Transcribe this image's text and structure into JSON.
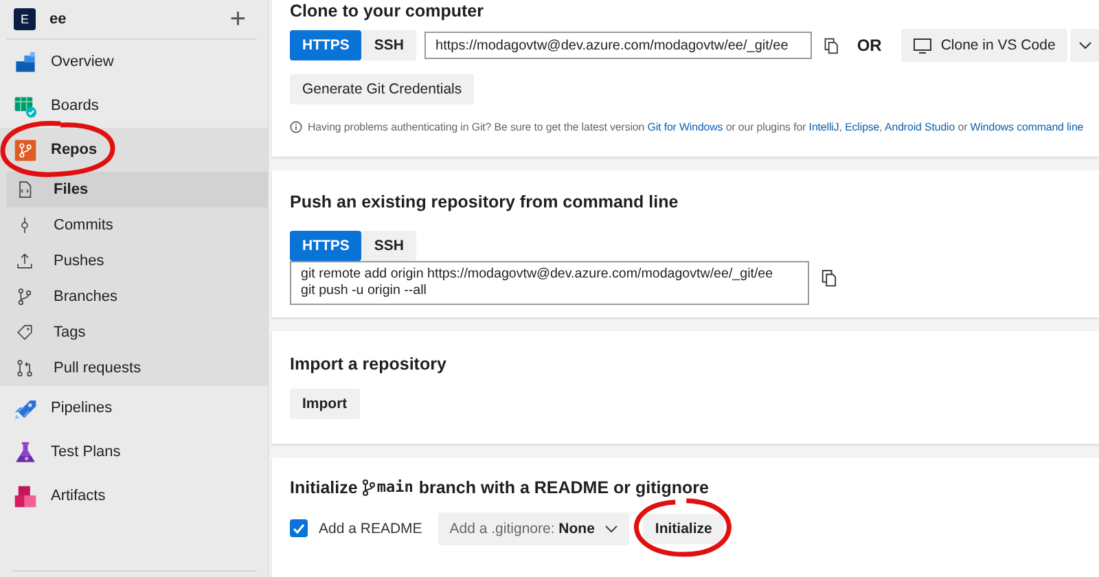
{
  "project": {
    "avatar": "E",
    "name": "ee",
    "add": "+"
  },
  "nav": [
    {
      "kind": "overview",
      "label": "Overview",
      "selected": false
    },
    {
      "kind": "boards",
      "label": "Boards",
      "selected": false
    },
    {
      "kind": "repos",
      "label": "Repos",
      "selected": false,
      "expanded": true,
      "children": [
        {
          "kind": "files",
          "label": "Files",
          "selected": true
        },
        {
          "kind": "commits",
          "label": "Commits",
          "selected": false
        },
        {
          "kind": "pushes",
          "label": "Pushes",
          "selected": false
        },
        {
          "kind": "branches",
          "label": "Branches",
          "selected": false
        },
        {
          "kind": "tags",
          "label": "Tags",
          "selected": false
        },
        {
          "kind": "pulls",
          "label": "Pull requests",
          "selected": false
        }
      ]
    },
    {
      "kind": "pipelines",
      "label": "Pipelines",
      "selected": false
    },
    {
      "kind": "testplans",
      "label": "Test Plans",
      "selected": false
    },
    {
      "kind": "artifacts",
      "label": "Artifacts",
      "selected": false
    }
  ],
  "clone": {
    "title": "Clone to your computer",
    "tabs": [
      {
        "label": "HTTPS",
        "selected": true
      },
      {
        "label": "SSH",
        "selected": false
      }
    ],
    "url": "https://modagovtw@dev.azure.com/modagovtw/ee/_git/ee",
    "or": "OR",
    "vscode_button": "Clone in VS Code",
    "credentials_button": "Generate Git Credentials",
    "help": [
      {
        "text": "Having problems authenticating in Git? Be sure to get the latest version ",
        "link": false
      },
      {
        "text": "Git for Windows",
        "link": true
      },
      {
        "text": " or our plugins for ",
        "link": false
      },
      {
        "text": "IntelliJ",
        "link": true
      },
      {
        "text": ", ",
        "link": false
      },
      {
        "text": "Eclipse",
        "link": true
      },
      {
        "text": ", ",
        "link": false
      },
      {
        "text": "Android Studio",
        "link": true
      },
      {
        "text": " or ",
        "link": false
      },
      {
        "text": "Windows command line",
        "link": true
      }
    ]
  },
  "push": {
    "title": "Push an existing repository from command line",
    "tabs": [
      {
        "label": "HTTPS",
        "selected": true
      },
      {
        "label": "SSH",
        "selected": false
      }
    ],
    "commands": [
      "git remote add origin https://modagovtw@dev.azure.com/modagovtw/ee/_git/ee",
      "git push -u origin --all"
    ]
  },
  "import": {
    "title": "Import a repository",
    "button": "Import"
  },
  "init": {
    "title_start": "Initialize",
    "branch": "main",
    "title_end": "branch with a README or gitignore",
    "readme": {
      "label": "Add a README",
      "checked": true
    },
    "gitignore": {
      "label": "Add a .gitignore:",
      "value": "None"
    },
    "button": "Initialize"
  }
}
